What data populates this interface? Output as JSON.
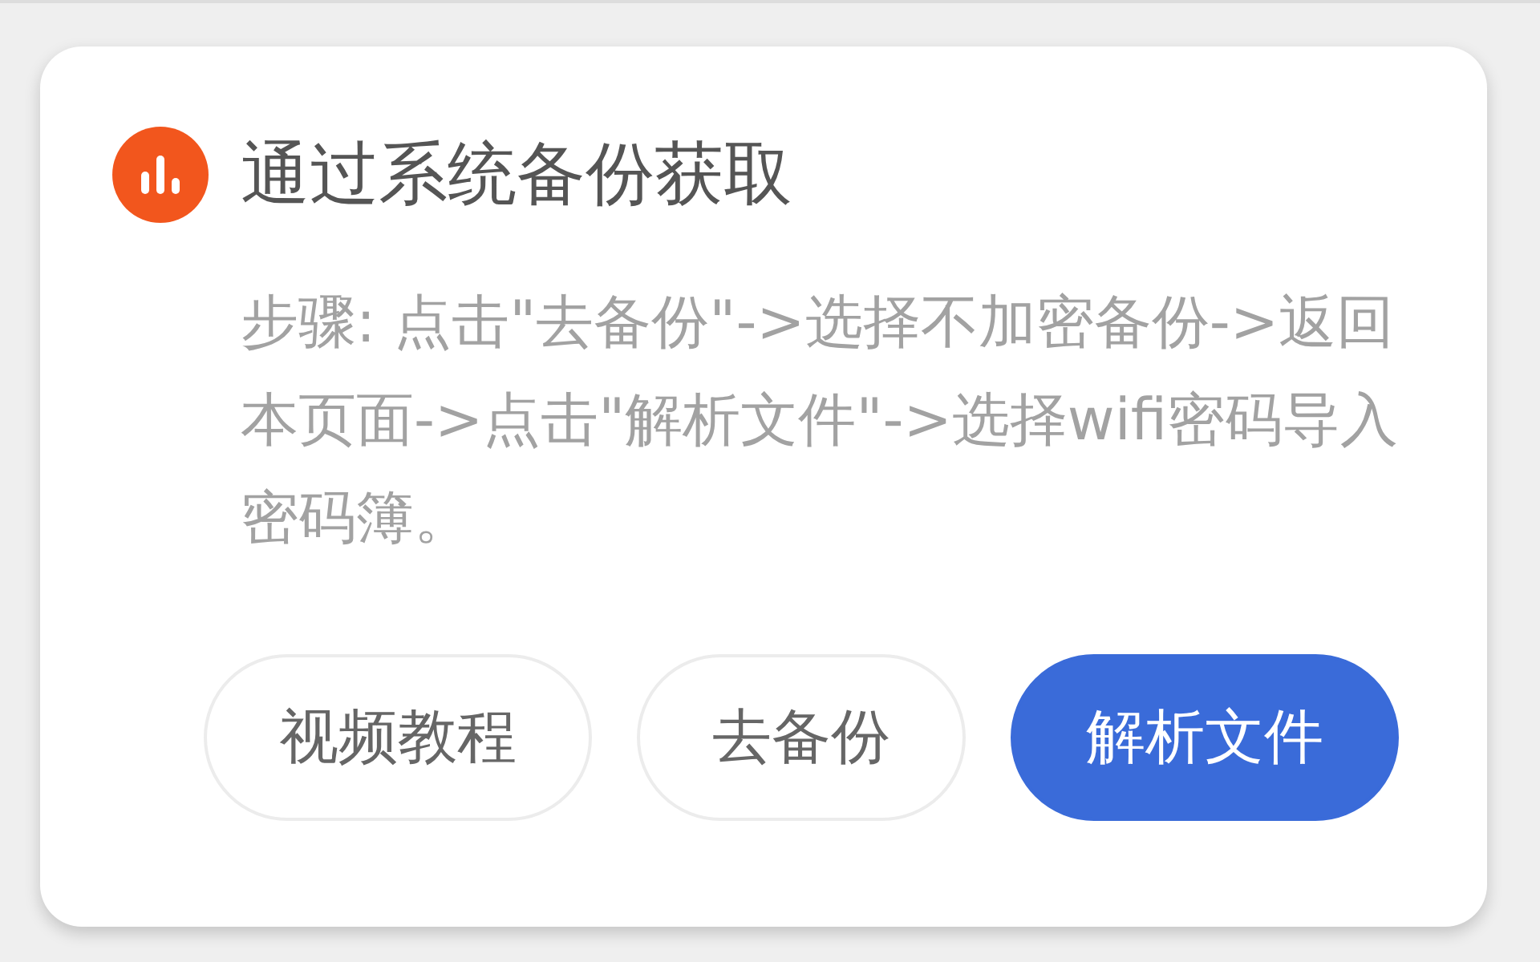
{
  "dialog": {
    "title": "通过系统备份获取",
    "description": "步骤: 点击\"去备份\"->选择不加密备份->返回本页面->点击\"解析文件\"->选择wifi密码导入密码簿。",
    "buttons": [
      {
        "label": "视频教程",
        "kind": "secondary"
      },
      {
        "label": "去备份",
        "kind": "secondary"
      },
      {
        "label": "解析文件",
        "kind": "primary"
      }
    ]
  }
}
